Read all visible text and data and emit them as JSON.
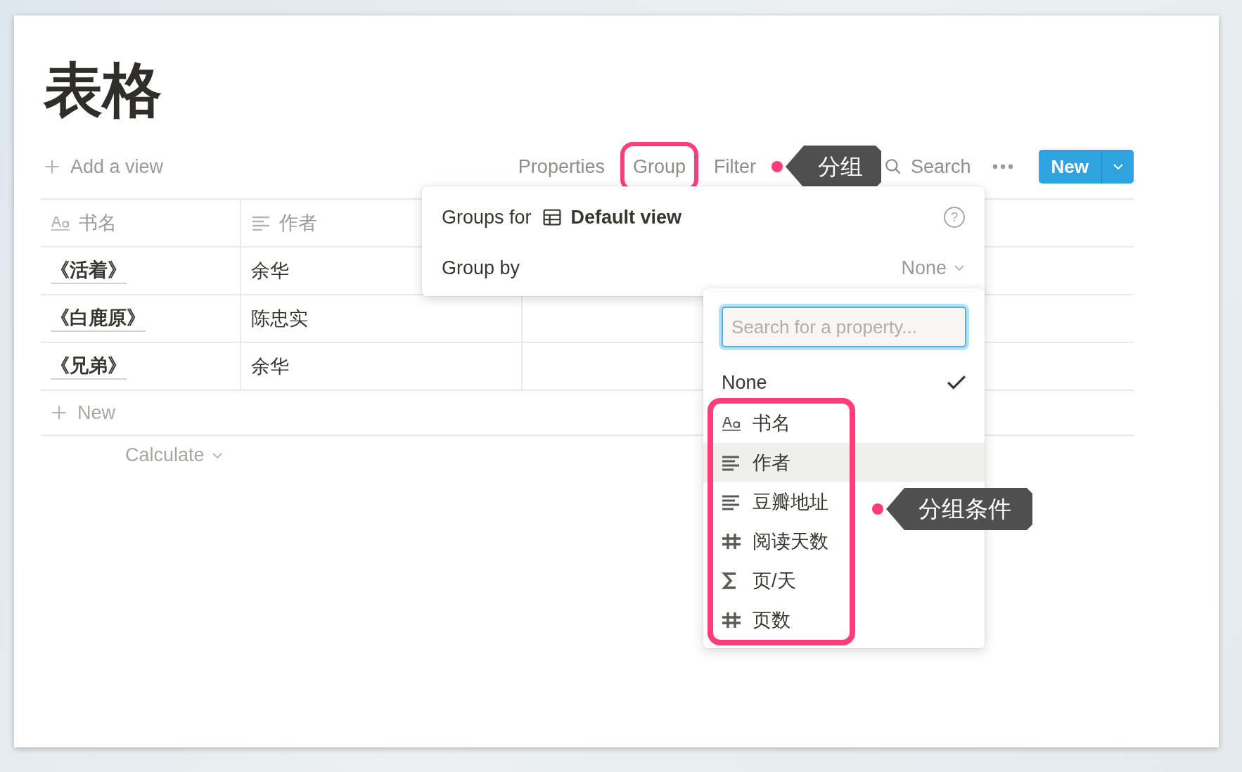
{
  "page": {
    "title": "表格"
  },
  "toolbar": {
    "add_view": "Add a view",
    "items": [
      {
        "label": "Properties",
        "highlighted": false
      },
      {
        "label": "Group",
        "highlighted": true
      },
      {
        "label": "Filter",
        "highlighted": false
      }
    ],
    "annotation": "分组",
    "search": "Search",
    "new_button": "New"
  },
  "table": {
    "columns": [
      {
        "kind": "title",
        "label": "书名"
      },
      {
        "kind": "text",
        "label": "作者"
      }
    ],
    "rows": [
      [
        "《活着》",
        "余华"
      ],
      [
        "《白鹿原》",
        "陈忠实"
      ],
      [
        "《兄弟》",
        "余华"
      ]
    ],
    "add_row": "New",
    "calculate": "Calculate"
  },
  "group_popup": {
    "title_prefix": "Groups for",
    "view_name": "Default view",
    "help": "?",
    "group_by_label": "Group by",
    "group_by_value": "None"
  },
  "property_menu": {
    "placeholder": "Search for a property...",
    "options_highlighted": true,
    "annotation": "分组条件",
    "none_option": {
      "label": "None",
      "selected": true
    },
    "options": [
      {
        "kind": "title",
        "label": "书名",
        "hovered": false
      },
      {
        "kind": "text",
        "label": "作者",
        "hovered": true
      },
      {
        "kind": "text",
        "label": "豆瓣地址",
        "hovered": false
      },
      {
        "kind": "number",
        "label": "阅读天数",
        "hovered": false
      },
      {
        "kind": "formula",
        "label": "页/天",
        "hovered": false
      },
      {
        "kind": "number",
        "label": "页数",
        "hovered": false
      }
    ]
  }
}
